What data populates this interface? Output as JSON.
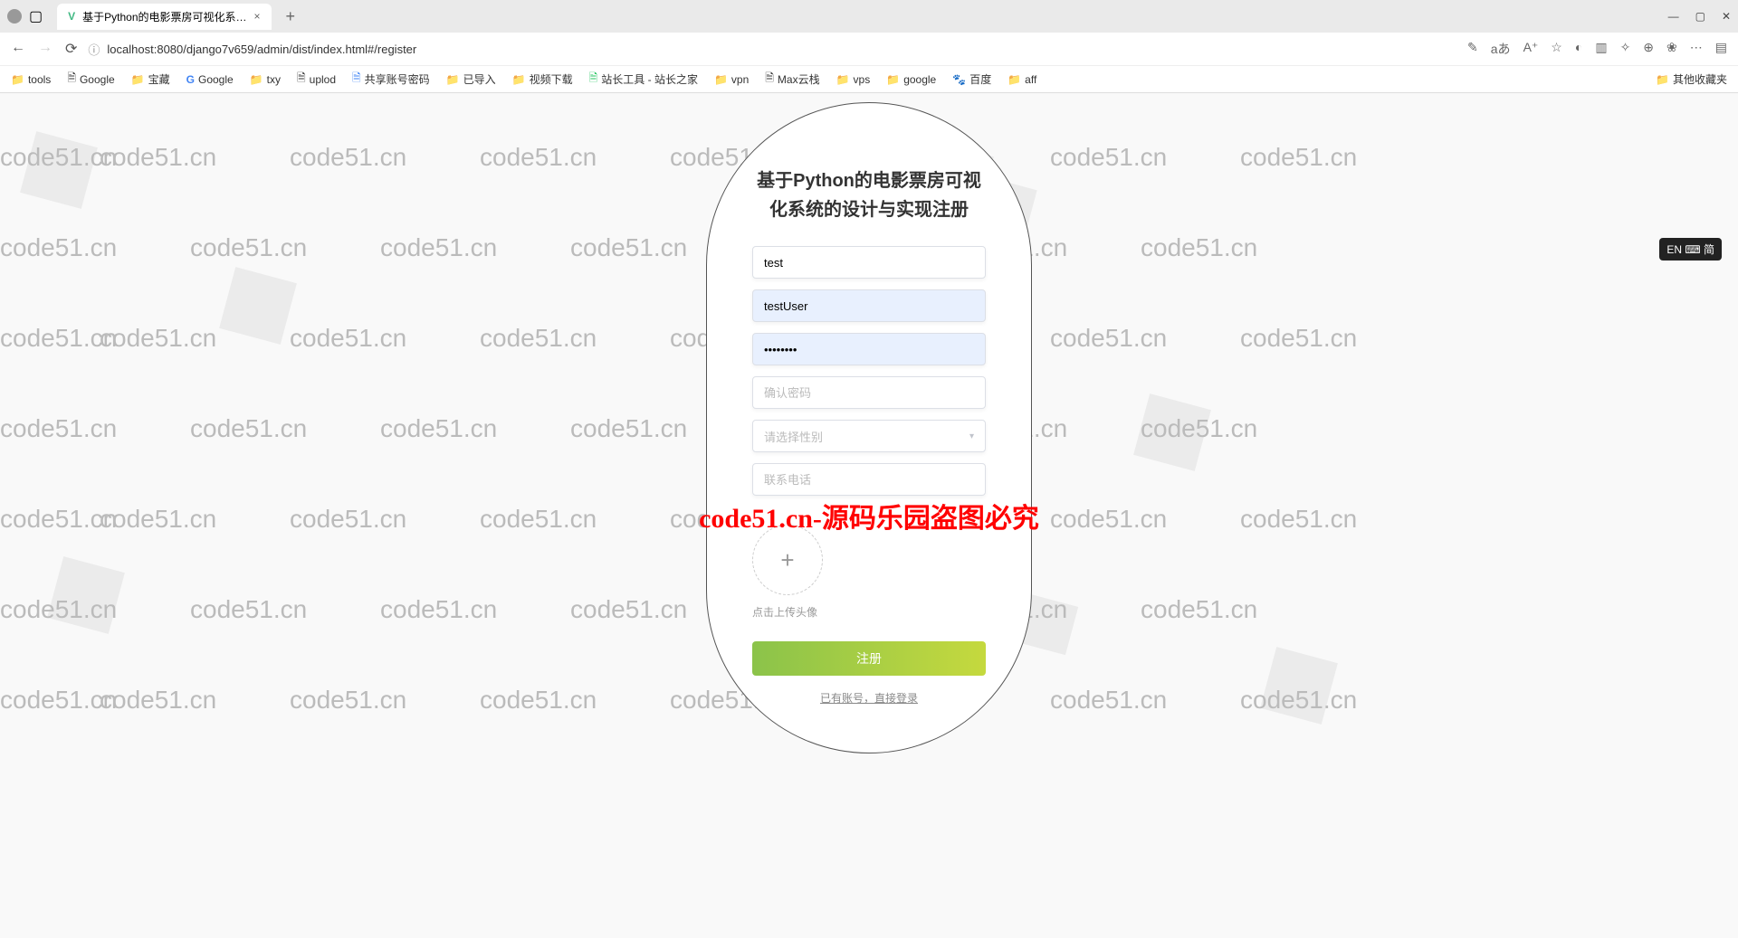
{
  "browser": {
    "tab_title": "基于Python的电影票房可视化系…",
    "url": "localhost:8080/django7v659/admin/dist/index.html#/register",
    "url_prefix": "localhost",
    "new_tab": "+"
  },
  "bookmarks": [
    {
      "label": "tools",
      "type": "folder"
    },
    {
      "label": "Google",
      "type": "page"
    },
    {
      "label": "宝藏",
      "type": "folder"
    },
    {
      "label": "Google",
      "type": "g"
    },
    {
      "label": "txy",
      "type": "folder"
    },
    {
      "label": "uplod",
      "type": "page"
    },
    {
      "label": "共享账号密码",
      "type": "page"
    },
    {
      "label": "已导入",
      "type": "folder"
    },
    {
      "label": "视频下载",
      "type": "folder"
    },
    {
      "label": "站长工具 - 站长之家",
      "type": "page"
    },
    {
      "label": "vpn",
      "type": "folder"
    },
    {
      "label": "Max云栈",
      "type": "page"
    },
    {
      "label": "vps",
      "type": "folder"
    },
    {
      "label": "google",
      "type": "folder"
    },
    {
      "label": "百度",
      "type": "page"
    },
    {
      "label": "aff",
      "type": "folder"
    }
  ],
  "bookmarks_right": "其他收藏夹",
  "register": {
    "title": "基于Python的电影票房可视化系统的设计与实现注册",
    "input_account": "test",
    "input_username": "testUser",
    "input_password": "••••••••",
    "placeholder_confirm": "确认密码",
    "placeholder_gender": "请选择性别",
    "placeholder_phone": "联系电话",
    "upload_hint": "点击上传头像",
    "button_label": "注册",
    "login_link": "已有账号，直接登录"
  },
  "watermark_text": "code51.cn",
  "center_watermark": "code51.cn-源码乐园盗图必究",
  "ime": "EN ⌨ 简"
}
